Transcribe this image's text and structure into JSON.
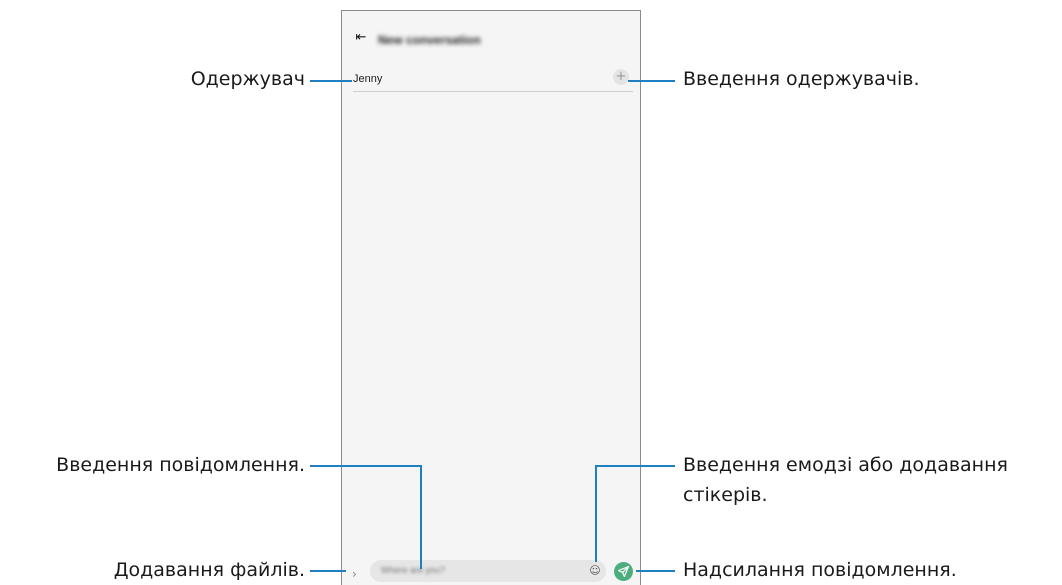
{
  "phone": {
    "back_glyph": "⇤",
    "title": "New conversation",
    "recipient": "Jenny",
    "add_recipient_glyph": "+",
    "expand_glyph": "›",
    "message_placeholder": "Where are you?",
    "emoji_glyph": "☺"
  },
  "callouts": {
    "recipient": "Одержувач",
    "enter_recipients": "Введення одержувачів.",
    "enter_message": "Введення повідомлення.",
    "emoji_line1": "Введення емодзі або додавання",
    "emoji_line2": "стікерів.",
    "attach_files": "Додавання файлів.",
    "send_message": "Надсилання повідомлення."
  },
  "colors": {
    "leader_line": "#1f7fc0",
    "send_button": "#4cae7f"
  },
  "icons": {
    "back": "back-arrow-icon",
    "add": "plus-icon",
    "expand": "chevron-right-icon",
    "emoji": "smiley-icon",
    "send": "send-icon"
  }
}
